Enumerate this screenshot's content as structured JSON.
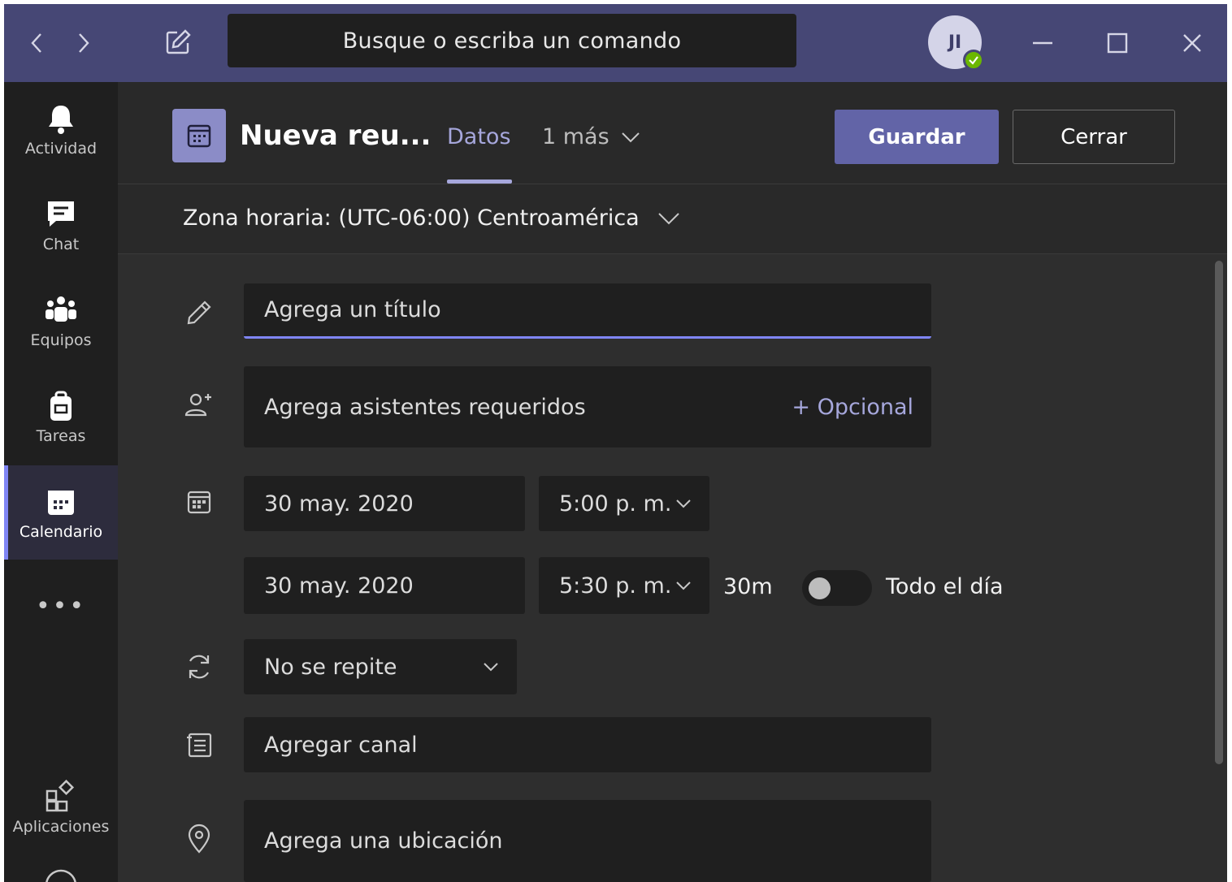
{
  "titlebar": {
    "search_placeholder": "Busque o escriba un comando",
    "avatar_initials": "JI",
    "presence_color": "#6bb700"
  },
  "rail": {
    "items": [
      {
        "label": "Actividad",
        "icon": "bell-icon"
      },
      {
        "label": "Chat",
        "icon": "chat-icon"
      },
      {
        "label": "Equipos",
        "icon": "teams-icon"
      },
      {
        "label": "Tareas",
        "icon": "tasks-icon"
      },
      {
        "label": "Calendario",
        "icon": "calendar-icon",
        "active": true
      },
      {
        "label": "Aplicaciones",
        "icon": "apps-icon"
      }
    ],
    "more": "•••"
  },
  "header": {
    "title": "Nueva reu...",
    "tab_active": "Datos",
    "tab_more": "1 más",
    "save_label": "Guardar",
    "close_label": "Cerrar"
  },
  "timezone": "Zona horaria: (UTC-06:00) Centroamérica",
  "form": {
    "title_placeholder": "Agrega un título",
    "attendees_placeholder": "Agrega asistentes requeridos",
    "optional_label": "+ Opcional",
    "start_date": "30 may. 2020",
    "start_time": "5:00 p. m.",
    "end_date": "30 may. 2020",
    "end_time": "5:30 p. m.",
    "duration": "30m",
    "all_day_label": "Todo el día",
    "all_day_on": false,
    "repeat": "No se repite",
    "channel_placeholder": "Agregar canal",
    "location_placeholder": "Agrega una ubicación"
  },
  "colors": {
    "accent": "#6264a7",
    "accent_light": "#a6a7dc",
    "titlebar": "#464775"
  }
}
